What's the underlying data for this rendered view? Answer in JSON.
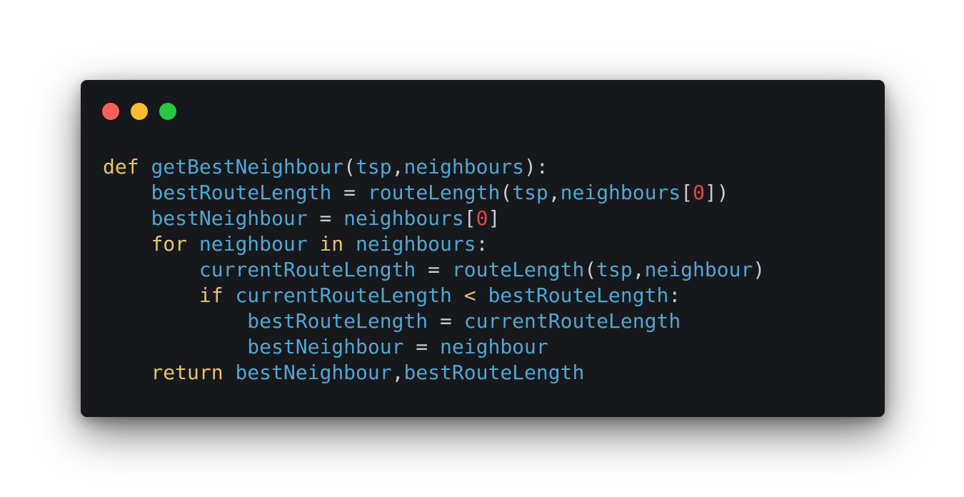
{
  "window": {
    "controls": [
      {
        "name": "close",
        "color": "#ff5f57"
      },
      {
        "name": "minimize",
        "color": "#febc2e"
      },
      {
        "name": "maximize",
        "color": "#28c840"
      }
    ]
  },
  "colors": {
    "background": "#17181b",
    "keyword": "#e6c46e",
    "identifier": "#4fa7d4",
    "number": "#e0474b",
    "punctuation": "#c6cdd4"
  },
  "code": {
    "language": "python",
    "lines": [
      {
        "indent": 0,
        "tokens": [
          {
            "t": "kw",
            "v": "def"
          },
          {
            "t": "p",
            "v": " "
          },
          {
            "t": "id",
            "v": "getBestNeighbour"
          },
          {
            "t": "p",
            "v": "("
          },
          {
            "t": "id",
            "v": "tsp"
          },
          {
            "t": "p",
            "v": ","
          },
          {
            "t": "id",
            "v": "neighbours"
          },
          {
            "t": "p",
            "v": "):"
          }
        ]
      },
      {
        "indent": 1,
        "tokens": [
          {
            "t": "id",
            "v": "bestRouteLength"
          },
          {
            "t": "op",
            "v": " = "
          },
          {
            "t": "id",
            "v": "routeLength"
          },
          {
            "t": "p",
            "v": "("
          },
          {
            "t": "id",
            "v": "tsp"
          },
          {
            "t": "p",
            "v": ","
          },
          {
            "t": "id",
            "v": "neighbours"
          },
          {
            "t": "p",
            "v": "["
          },
          {
            "t": "num",
            "v": "0"
          },
          {
            "t": "p",
            "v": "])"
          }
        ]
      },
      {
        "indent": 1,
        "tokens": [
          {
            "t": "id",
            "v": "bestNeighbour"
          },
          {
            "t": "op",
            "v": " = "
          },
          {
            "t": "id",
            "v": "neighbours"
          },
          {
            "t": "p",
            "v": "["
          },
          {
            "t": "num",
            "v": "0"
          },
          {
            "t": "p",
            "v": "]"
          }
        ]
      },
      {
        "indent": 1,
        "tokens": [
          {
            "t": "kw",
            "v": "for"
          },
          {
            "t": "p",
            "v": " "
          },
          {
            "t": "id",
            "v": "neighbour"
          },
          {
            "t": "p",
            "v": " "
          },
          {
            "t": "kw",
            "v": "in"
          },
          {
            "t": "p",
            "v": " "
          },
          {
            "t": "id",
            "v": "neighbours"
          },
          {
            "t": "p",
            "v": ":"
          }
        ]
      },
      {
        "indent": 2,
        "tokens": [
          {
            "t": "id",
            "v": "currentRouteLength"
          },
          {
            "t": "op",
            "v": " = "
          },
          {
            "t": "id",
            "v": "routeLength"
          },
          {
            "t": "p",
            "v": "("
          },
          {
            "t": "id",
            "v": "tsp"
          },
          {
            "t": "p",
            "v": ","
          },
          {
            "t": "id",
            "v": "neighbour"
          },
          {
            "t": "p",
            "v": ")"
          }
        ]
      },
      {
        "indent": 2,
        "tokens": [
          {
            "t": "kw",
            "v": "if"
          },
          {
            "t": "p",
            "v": " "
          },
          {
            "t": "id",
            "v": "currentRouteLength"
          },
          {
            "t": "op",
            "v": " "
          },
          {
            "t": "kw",
            "v": "<"
          },
          {
            "t": "op",
            "v": " "
          },
          {
            "t": "id",
            "v": "bestRouteLength"
          },
          {
            "t": "p",
            "v": ":"
          }
        ]
      },
      {
        "indent": 3,
        "tokens": [
          {
            "t": "id",
            "v": "bestRouteLength"
          },
          {
            "t": "op",
            "v": " = "
          },
          {
            "t": "id",
            "v": "currentRouteLength"
          }
        ]
      },
      {
        "indent": 3,
        "tokens": [
          {
            "t": "id",
            "v": "bestNeighbour"
          },
          {
            "t": "op",
            "v": " = "
          },
          {
            "t": "id",
            "v": "neighbour"
          }
        ]
      },
      {
        "indent": 1,
        "tokens": [
          {
            "t": "kw",
            "v": "return"
          },
          {
            "t": "p",
            "v": " "
          },
          {
            "t": "id",
            "v": "bestNeighbour"
          },
          {
            "t": "p",
            "v": ","
          },
          {
            "t": "id",
            "v": "bestRouteLength"
          }
        ]
      }
    ]
  }
}
